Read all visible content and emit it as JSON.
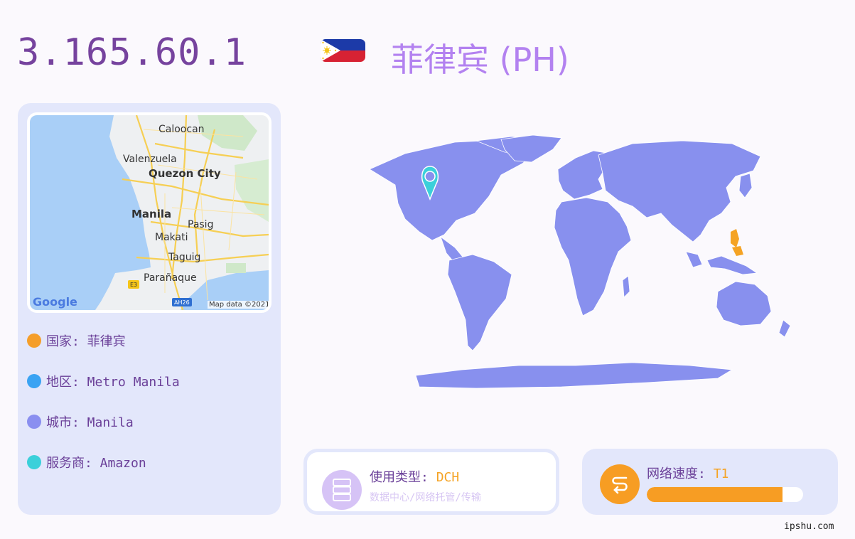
{
  "header": {
    "ip": "3.165.60.1",
    "country_title": "菲律宾 (PH)"
  },
  "map_thumb": {
    "places": [
      "Caloocan",
      "Valenzuela",
      "Quezon City",
      "Manila",
      "Pasig",
      "Makati",
      "Taguig",
      "Parañaque"
    ],
    "road_badges": [
      "E3",
      "AH26"
    ],
    "logo": "Google",
    "attribution": "Map data ©2021"
  },
  "info": [
    {
      "label": "国家: 菲律宾",
      "color": "#f59e2a"
    },
    {
      "label": "地区: Metro Manila",
      "color": "#3aa3f3"
    },
    {
      "label": "城市: Manila",
      "color": "#8a8ff0"
    },
    {
      "label": "服务商: Amazon",
      "color": "#3bd0da"
    }
  ],
  "usage": {
    "label": "使用类型: ",
    "value": "DCH",
    "sub": "数据中心/网络托管/传输",
    "icon": "server-icon"
  },
  "speed": {
    "label": "网络速度: ",
    "value": "T1",
    "progress": 0.87,
    "icon": "speed-icon"
  },
  "colors": {
    "accent": "#76439e",
    "map_land": "#8890ee",
    "highlight": "#f5a324",
    "pin": "#3bd0da"
  },
  "watermark": "ipshu.com"
}
